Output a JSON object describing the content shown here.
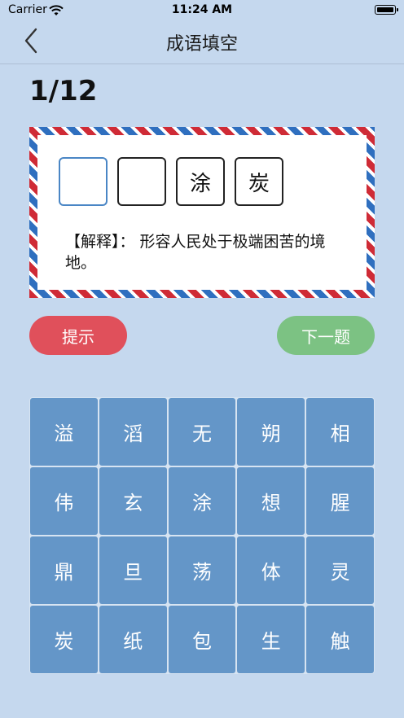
{
  "status_bar": {
    "carrier": "Carrier",
    "time": "11:24 AM",
    "wifi_icon": "wifi-icon",
    "battery_icon": "battery-icon"
  },
  "nav": {
    "back_icon": "chevron-left-icon",
    "title": "成语填空"
  },
  "progress": "1/12",
  "slots": [
    "",
    "",
    "涂",
    "炭"
  ],
  "explanation": "【解释】： 形容人民处于极端困苦的境地。",
  "buttons": {
    "hint": "提示",
    "next": "下一题"
  },
  "grid": [
    [
      "溢",
      "滔",
      "无",
      "朔",
      "相"
    ],
    [
      "伟",
      "玄",
      "涂",
      "想",
      "腥"
    ],
    [
      "鼎",
      "旦",
      "荡",
      "体",
      "灵"
    ],
    [
      "炭",
      "纸",
      "包",
      "生",
      "触"
    ]
  ],
  "colors": {
    "background": "#c5d8ee",
    "tile": "#6496c8",
    "hint_button": "#e0505b",
    "next_button": "#7cc283",
    "airmail_red": "#cf2b36",
    "airmail_blue": "#2f6fbf",
    "active_slot_border": "#4a86c5"
  }
}
